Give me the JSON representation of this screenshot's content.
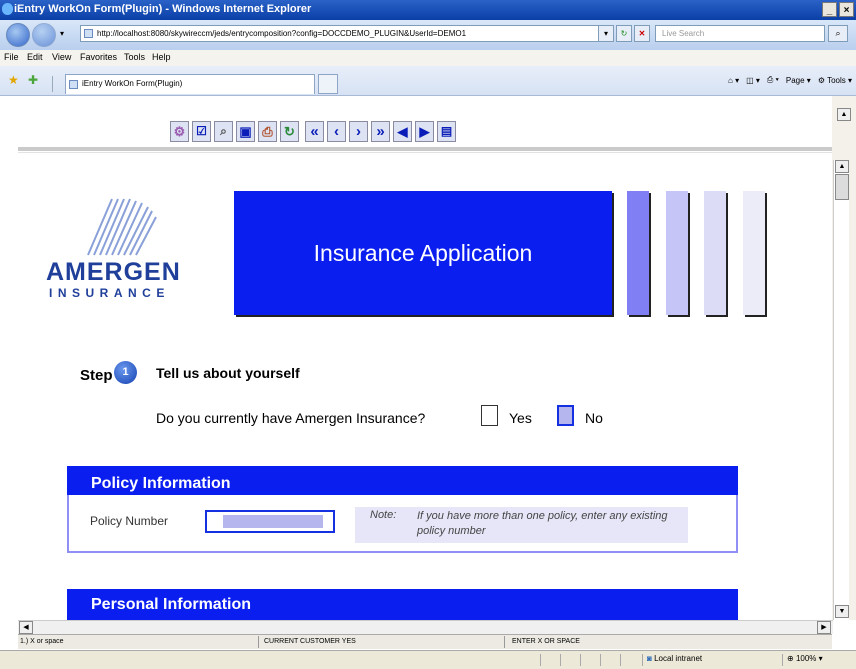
{
  "window": {
    "title": "iEntry WorkOn Form(Plugin) - Windows Internet Explorer",
    "controls": [
      "_",
      "×"
    ]
  },
  "address": {
    "url": "http://localhost:8080/skywireccm/jeds/entrycomposition?config=DOCCDEMO_PLUGIN&UserId=DEMO1"
  },
  "search": {
    "placeholder": "Live Search"
  },
  "menu": [
    "File",
    "Edit",
    "View",
    "Favorites",
    "Tools",
    "Help"
  ],
  "tab": {
    "title": "iEntry WorkOn Form(Plugin)"
  },
  "commandbar": {
    "page": "Page",
    "tools": "Tools"
  },
  "form_toolbar": {
    "icons": [
      "settings-icon",
      "check-form-icon",
      "search-icon",
      "save-icon",
      "print-icon",
      "refresh-icon",
      "first-page-icon",
      "previous-page-icon",
      "next-page-icon",
      "last-page-icon",
      "back-icon",
      "forward-icon",
      "view-icon"
    ]
  },
  "logo": {
    "name": "AMERGEN",
    "sub": "INSURANCE"
  },
  "banner": {
    "title": "Insurance Application",
    "bar_colors": [
      "#8080f4",
      "#c5c5f8",
      "#dcdcf6",
      "#ececf9"
    ]
  },
  "step": {
    "label": "Step",
    "number": "1",
    "title": "Tell us about yourself",
    "question": "Do you currently have Amergen Insurance?",
    "options": [
      {
        "label": "Yes",
        "checked": false
      },
      {
        "label": "No",
        "checked": true
      }
    ]
  },
  "policy": {
    "header": "Policy Information",
    "field_label": "Policy Number",
    "note_label": "Note:",
    "note_text": "If you have more than one policy, enter any existing policy number"
  },
  "personal": {
    "header": "Personal Information"
  },
  "statusbar": {
    "hint": "1.) X or space",
    "field_status": "CURRENT CUSTOMER YES",
    "instruction": "ENTER X OR SPACE",
    "zone": "Local intranet",
    "zoom": "100%"
  },
  "colors": {
    "accent": "#0b1ef0",
    "logo": "#1f3f9a",
    "border": "#8f8ff6"
  }
}
